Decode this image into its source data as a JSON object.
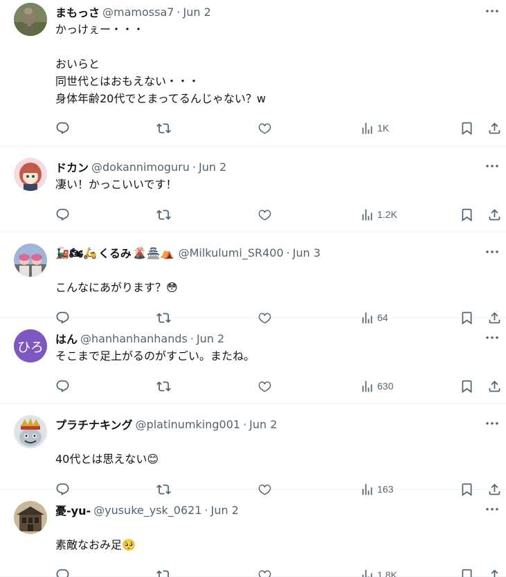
{
  "tweets": [
    {
      "name": "まもっさ",
      "name_emoji": "",
      "handle": "@mamossa7",
      "date": "Jun 2",
      "text": "かっけぇー・・・\n\nおいらと\n同世代とはおもえない・・・\n身体年齢20代でとまってるんじゃない？w",
      "text_emoji": "",
      "views": "1K",
      "avatar": "mole-photo-avatar"
    },
    {
      "name": "ドカン",
      "name_emoji": "",
      "handle": "@dokannimoguru",
      "date": "Jun 2",
      "text": "凄い！かっこいいです！",
      "text_emoji": "",
      "views": "1.2K",
      "avatar": "anime-girl-avatar"
    },
    {
      "name": "くるみ",
      "name_emoji": "🚂🏍🛵",
      "name_emoji_after": "🌋🏯⛺",
      "handle": "@Milkulumi_SR400",
      "date": "Jun 3",
      "text": "こんなにあがります？",
      "text_emoji": "😳",
      "views": "64",
      "avatar": "group-photo-avatar"
    },
    {
      "name": "はん",
      "name_emoji": "",
      "handle": "@hanhanhanhands",
      "date": "Jun 2",
      "text": "そこまで足上がるのがすごい。またね。",
      "text_emoji": "",
      "views": "630",
      "avatar": "ひろ"
    },
    {
      "name": "プラチナキング",
      "name_emoji": "",
      "handle": "@platinumking001",
      "date": "Jun 2",
      "text": "40代とは思えない",
      "text_emoji": "😊",
      "views": "163",
      "avatar": "king-slime-avatar"
    },
    {
      "name": "憂-yu-",
      "name_emoji": "",
      "handle": "@yusuke_ysk_0621",
      "date": "Jun 2",
      "text": "素敵なおみ足",
      "text_emoji": "🥺",
      "views": "1.8K",
      "avatar": "building-photo-avatar"
    }
  ],
  "colors": {
    "text": "#0f1419",
    "secondary": "#536471",
    "divider": "#eff3f4",
    "hiro_avatar_bg": "#7e57c2"
  }
}
